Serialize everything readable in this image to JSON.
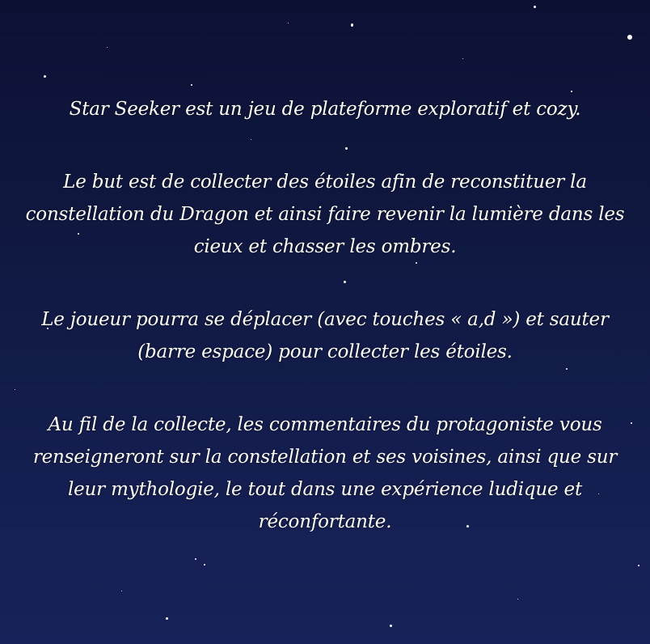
{
  "intro": {
    "paragraphs": [
      "Star Seeker est un jeu de plateforme exploratif et cozy.",
      "Le but est de collecter des étoiles afin de reconstituer la constellation du Dragon et ainsi faire revenir la lumière dans les cieux et chasser les ombres.",
      "Le joueur pourra se déplacer (avec touches « a,d ») et sauter (barre espace) pour collecter les étoiles.",
      "Au fil de la collecte, les commentaires du protagoniste vous renseigneront sur la constellation et ses voisines, ainsi que sur leur mythologie, le tout dans une expérience ludique et réconfortante."
    ]
  },
  "colors": {
    "sky_top": "#0c1134",
    "sky_bottom": "#17225a",
    "text": "#ffffff"
  }
}
